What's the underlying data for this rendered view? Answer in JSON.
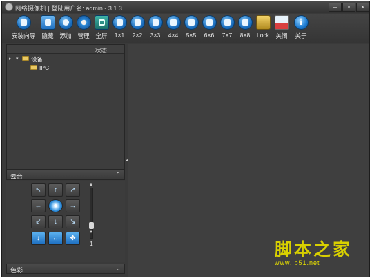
{
  "window": {
    "title": "网络摄像机 | 登陆用户名: admin - 3.1.3",
    "minimize": "–",
    "maximize": "▫",
    "close": "×"
  },
  "toolbar": {
    "items": [
      {
        "label": "安装向导",
        "icon": "wizard-icon"
      },
      {
        "label": "隐藏",
        "icon": "hide-icon"
      },
      {
        "label": "添加",
        "icon": "search-add-icon"
      },
      {
        "label": "管理",
        "icon": "gear-icon"
      },
      {
        "label": "全屏",
        "icon": "fullscreen-icon"
      },
      {
        "label": "1×1",
        "icon": "layout-1x1-icon"
      },
      {
        "label": "2×2",
        "icon": "layout-2x2-icon"
      },
      {
        "label": "3×3",
        "icon": "layout-3x3-icon"
      },
      {
        "label": "4×4",
        "icon": "layout-4x4-icon"
      },
      {
        "label": "5×5",
        "icon": "layout-5x5-icon"
      },
      {
        "label": "6×6",
        "icon": "layout-6x6-icon"
      },
      {
        "label": "7×7",
        "icon": "layout-7x7-icon"
      },
      {
        "label": "8×8",
        "icon": "layout-8x8-icon"
      },
      {
        "label": "Lock",
        "icon": "lock-icon"
      },
      {
        "label": "关闭",
        "icon": "close-window-icon"
      },
      {
        "label": "关于",
        "icon": "info-icon"
      }
    ]
  },
  "tree": {
    "status_header": "状态",
    "root": {
      "label": "设备",
      "expander": "▸",
      "collapse": "▾"
    },
    "child": {
      "label": "IPC"
    }
  },
  "panels": {
    "ptz_title": "云台",
    "ptz_toggle": "⌃",
    "color_title": "色彩",
    "color_toggle": "⌄"
  },
  "ptz": {
    "buttons": [
      "↖",
      "↑",
      "↗",
      "←",
      "●",
      "→",
      "↙",
      "↓",
      "↘",
      "↕",
      "↔",
      "✥"
    ],
    "speed_value": "1",
    "speed_level": 0.68,
    "scroll_up": "▲",
    "scroll_down": "▼"
  },
  "splitter_arrow": "◂",
  "watermark": {
    "text": "脚本之家",
    "url": "www.jb51.net"
  }
}
